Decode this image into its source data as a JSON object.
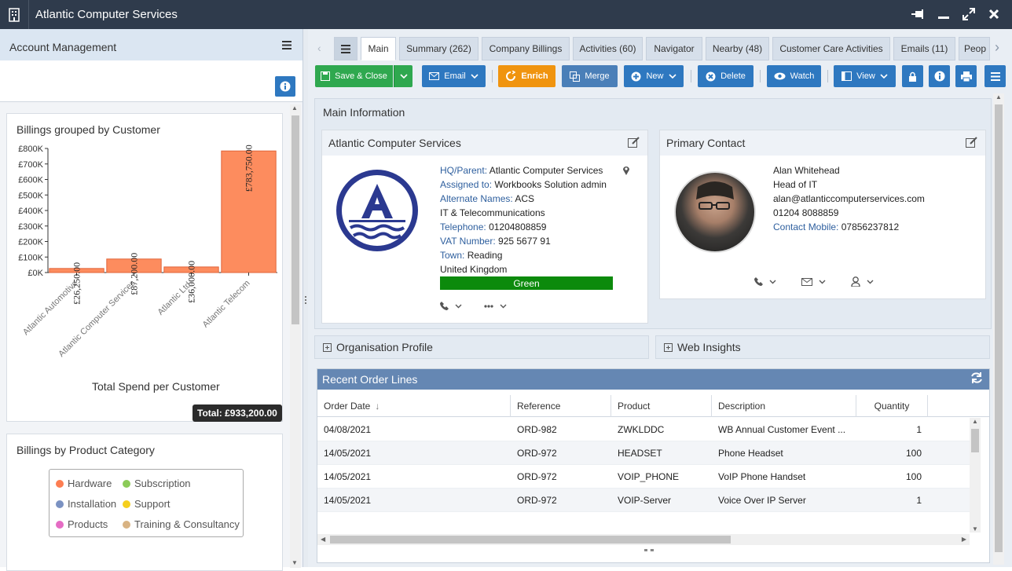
{
  "window": {
    "title": "Atlantic Computer Services",
    "icons": [
      "building-icon",
      "pin-icon",
      "minimize-icon",
      "maximize-icon",
      "close-icon"
    ]
  },
  "left": {
    "header": "Account Management",
    "chart_card_title": "Billings grouped by Customer",
    "chart_data": {
      "type": "bar",
      "title": "Billings grouped by Customer",
      "categories": [
        "Atlantic Automotive",
        "Atlantic Computer Services",
        "Atlantic Ltd.",
        "Atlantic Telecom"
      ],
      "values": [
        26250,
        87200,
        36000,
        783750
      ],
      "data_labels": [
        "£26,250.00",
        "£87,200.00",
        "£36,000.00",
        "£783,750.00"
      ],
      "yticks": [
        "£0K",
        "£100K",
        "£200K",
        "£300K",
        "£400K",
        "£500K",
        "£600K",
        "£700K",
        "£800K"
      ],
      "ylim": [
        0,
        800000
      ],
      "xlabel": "Total Spend per Customer",
      "color": "#fd8c5e",
      "total_badge": "Total: £933,200.00"
    },
    "category_card_title": "Billings by Product Category",
    "legend": [
      {
        "label": "Hardware",
        "color": "#fd7e52"
      },
      {
        "label": "Subscription",
        "color": "#8ccb59"
      },
      {
        "label": "Installation",
        "color": "#7b92c2"
      },
      {
        "label": "Support",
        "color": "#f5cf1e"
      },
      {
        "label": "Products",
        "color": "#e56cc4"
      },
      {
        "label": "Training & Consultancy",
        "color": "#d8b383"
      }
    ]
  },
  "tabs": [
    {
      "label": "Main"
    },
    {
      "label": "Summary (262)"
    },
    {
      "label": "Company Billings"
    },
    {
      "label": "Activities (60)"
    },
    {
      "label": "Navigator"
    },
    {
      "label": "Nearby (48)"
    },
    {
      "label": "Customer Care Activities"
    },
    {
      "label": "Emails (11)"
    },
    {
      "label": "Peop"
    }
  ],
  "toolbar": {
    "save_close": "Save & Close",
    "email": "Email",
    "enrich": "Enrich",
    "merge": "Merge",
    "new": "New",
    "delete": "Delete",
    "watch": "Watch",
    "view": "View"
  },
  "main": {
    "section_title": "Main Information",
    "org": {
      "title": "Atlantic Computer Services",
      "fields": [
        {
          "label": "HQ/Parent:",
          "value": "Atlantic Computer Services"
        },
        {
          "label": "Assigned to:",
          "value": "Workbooks Solution admin"
        },
        {
          "label": "Alternate Names:",
          "value": "ACS"
        },
        {
          "label": "",
          "value": "IT & Telecommunications"
        },
        {
          "label": "Telephone:",
          "value": "01204808859"
        },
        {
          "label": "VAT Number:",
          "value": "925 5677 91"
        },
        {
          "label": "Town:",
          "value": "Reading"
        },
        {
          "label": "",
          "value": "United Kingdom"
        }
      ],
      "status": "Green",
      "status_color": "#0c8a0c"
    },
    "contact": {
      "title": "Primary Contact",
      "name": "Alan Whitehead",
      "role": "Head of IT",
      "email": "alan@atlanticcomputerservices.com",
      "phone": "01204 8088859",
      "mobile_label": "Contact Mobile:",
      "mobile": "07856237812"
    },
    "org_profile": "Organisation Profile",
    "web_insights": "Web Insights"
  },
  "orders": {
    "title": "Recent Order Lines",
    "columns": [
      "Order Date",
      "Reference",
      "Product",
      "Description",
      "Quantity"
    ],
    "rows": [
      {
        "date": "04/08/2021",
        "ref": "ORD-982",
        "product": "ZWKLDDC",
        "desc": "WB Annual Customer Event ...",
        "qty": "1"
      },
      {
        "date": "14/05/2021",
        "ref": "ORD-972",
        "product": "HEADSET",
        "desc": "Phone Headset",
        "qty": "100"
      },
      {
        "date": "14/05/2021",
        "ref": "ORD-972",
        "product": "VOIP_PHONE",
        "desc": "VoIP Phone Handset",
        "qty": "100"
      },
      {
        "date": "14/05/2021",
        "ref": "ORD-972",
        "product": "VOIP-Server",
        "desc": "Voice Over IP Server",
        "qty": "1"
      }
    ]
  }
}
